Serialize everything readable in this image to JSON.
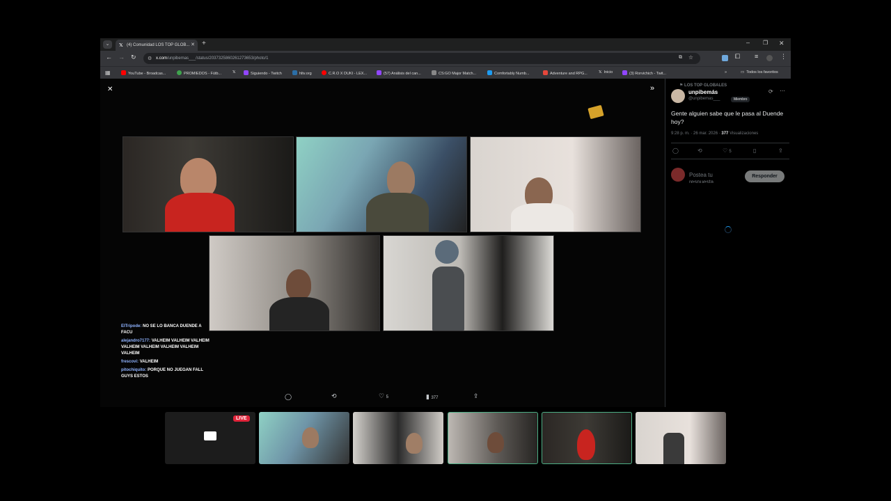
{
  "browser": {
    "tab_title": "(4) Comunidad LOS TOP GLOB...",
    "url_domain": "x.com",
    "url_path": "/unpibemas___/status/2037325860261273653/photo/1",
    "bookmarks": [
      {
        "label": "YouTube - Broadcas...",
        "color": "#ff0000"
      },
      {
        "label": "PROMIEDOS - Fútb...",
        "color": "#3fa34d"
      },
      {
        "label": "X",
        "color": "#444444"
      },
      {
        "label": "Siguiendo - Twitch",
        "color": "#9146ff"
      },
      {
        "label": "hltv.org",
        "color": "#2b6ea6"
      },
      {
        "label": "C.R.O X DUKI - LEX...",
        "color": "#ff0000"
      },
      {
        "label": "(57) Análisis del can...",
        "color": "#9146ff"
      },
      {
        "label": "CS:GO Major Match...",
        "color": "#888888"
      },
      {
        "label": "Comfortably Numb...",
        "color": "#1d9bf0"
      },
      {
        "label": "Adventure and RPG...",
        "color": "#e5473b"
      },
      {
        "label": "Inicio",
        "color": "#444444"
      },
      {
        "label": "(3) Rorvichich - Twit...",
        "color": "#9146ff"
      }
    ],
    "all_favorites_label": "Todos los favoritos"
  },
  "stream_chat": [
    {
      "user": "ElTripode:",
      "text": "NO SE LO BANCA DUENDE A FACU"
    },
    {
      "user": "alejandro7177:",
      "text": "VALHEIM VALHEIM VALHEIM VALHEIM VALHEIM VALHEIM VALHEIM VALHEIM"
    },
    {
      "user": "frescovi:",
      "text": "VALHEIM"
    },
    {
      "user": "pitochiquito:",
      "text": "PORQUE NO JUEGAN FALL GUYS ESTOS"
    }
  ],
  "viewer_actions": {
    "likes": "5",
    "views": "377"
  },
  "tweet": {
    "community": "LOS TOP GLOBALES",
    "display_name": "unpibemás",
    "handle": "@unpibemas___",
    "role_badge": "Miembro",
    "text": "Gente alguien sabe que le pasa al Duende hoy?",
    "time": "9:28 p. m. · 26 mar. 2026 ·",
    "views": "377",
    "views_label": "Visualizaciones",
    "likes": "5",
    "reply_placeholder": "Postea tu respuesta",
    "reply_button": "Responder"
  },
  "live_badge": "LIVE",
  "colors": {
    "accent": "#1d9bf0",
    "live": "#e0243a",
    "active_border": "#4caf85"
  }
}
